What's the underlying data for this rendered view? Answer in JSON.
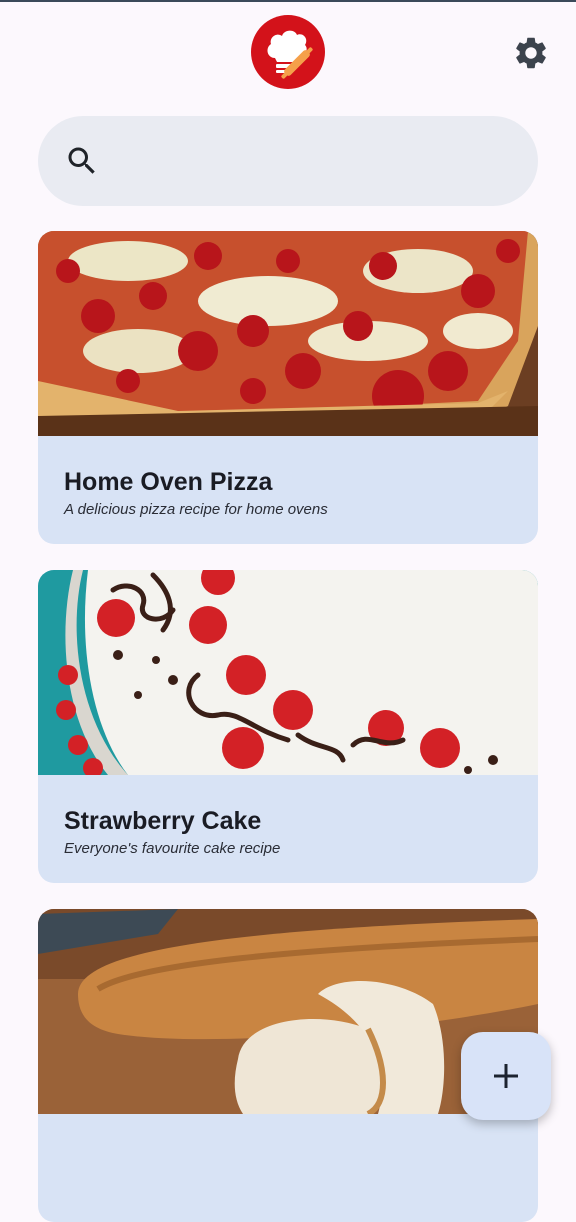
{
  "app": {
    "logo_icon": "chef-hat-rolling-pin-icon",
    "settings_icon": "gear-icon",
    "search_icon": "search-icon",
    "add_icon": "plus-icon",
    "accent": "#d3121a"
  },
  "search": {
    "placeholder": ""
  },
  "recipes": [
    {
      "title": "Home Oven Pizza",
      "description": "A delicious pizza recipe for home ovens",
      "image": "pizza-photo"
    },
    {
      "title": "Strawberry Cake",
      "description": "Everyone's favourite cake recipe",
      "image": "strawberry-cake-photo"
    },
    {
      "title": "",
      "description": "",
      "image": "bread-photo"
    }
  ]
}
